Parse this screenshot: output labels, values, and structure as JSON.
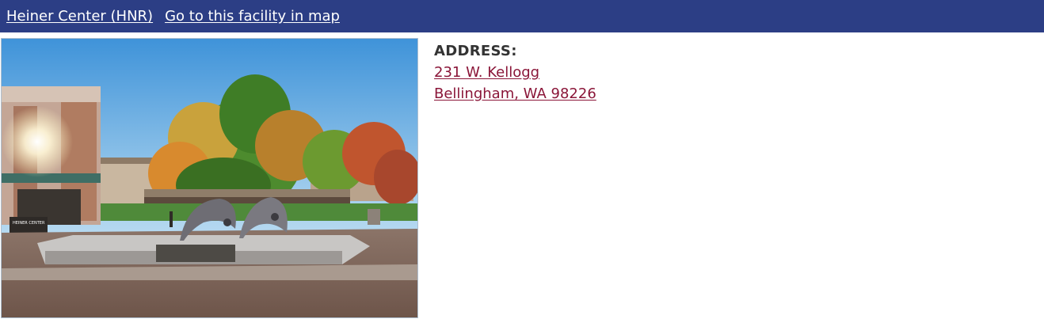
{
  "header": {
    "facility_link": "Heiner Center (HNR)",
    "map_link": "Go to this facility in map"
  },
  "photo": {
    "alt": "Heiner Center (HNR)",
    "sign_text": "HEINER CENTER"
  },
  "address": {
    "heading": "ADDRESS:",
    "line1": "231 W. Kellogg",
    "line2": "Bellingham, WA 98226"
  },
  "colors": {
    "header_bg": "#2c3e85",
    "link": "#8a1538"
  }
}
